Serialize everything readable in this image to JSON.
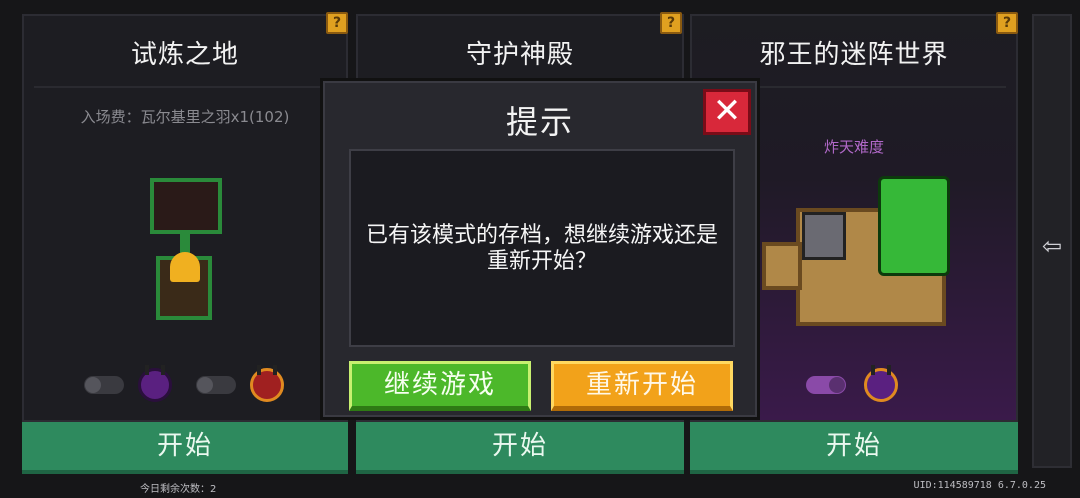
{
  "panels": [
    {
      "title": "试炼之地",
      "fee": "入场费：瓦尔基里之羽x1(102)",
      "start_label": "开始"
    },
    {
      "title": "守护神殿",
      "start_label": "开始"
    },
    {
      "title": "邪王的迷阵世界",
      "tag": "炸天难度",
      "start_label": "开始"
    }
  ],
  "help_label": "?",
  "dialog": {
    "title": "提示",
    "message": "已有该模式的存档，想继续游戏还是重新开始？",
    "continue_label": "继续游戏",
    "restart_label": "重新开始",
    "close_label": "✕"
  },
  "footer": {
    "remaining": "今日剩余次数：2",
    "uid": "UID:114589718 6.7.0.25"
  },
  "icons": {
    "exit": "exit-icon",
    "close": "close-icon",
    "help": "help-icon"
  }
}
